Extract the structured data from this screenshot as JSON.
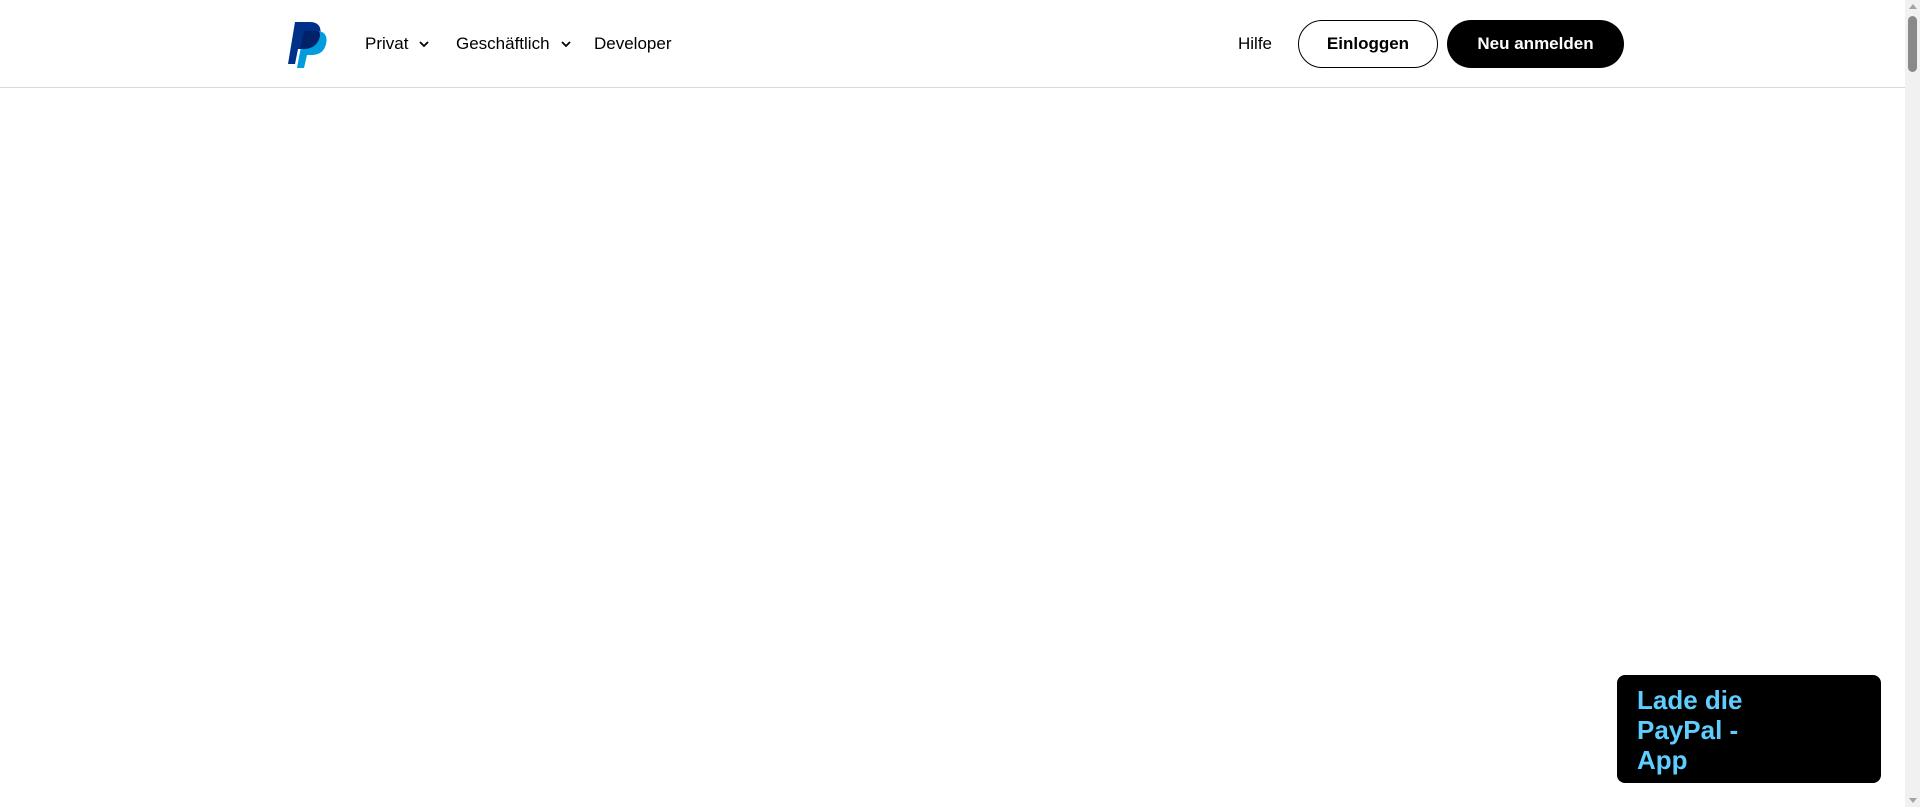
{
  "header": {
    "logo_icon": "paypal-logo-icon",
    "nav": [
      {
        "label": "Privat",
        "has_dropdown": true
      },
      {
        "label": "Geschäftlich",
        "has_dropdown": true
      },
      {
        "label": "Developer",
        "has_dropdown": false
      }
    ],
    "help_label": "Hilfe",
    "login_label": "Einloggen",
    "signup_label": "Neu anmelden"
  },
  "app_banner": {
    "text": "Lade die PayPal - App"
  },
  "colors": {
    "logo_dark": "#003087",
    "logo_light": "#009cde",
    "logo_overlap": "#012169",
    "banner_text": "#60cdff",
    "button_dark": "#000000"
  }
}
